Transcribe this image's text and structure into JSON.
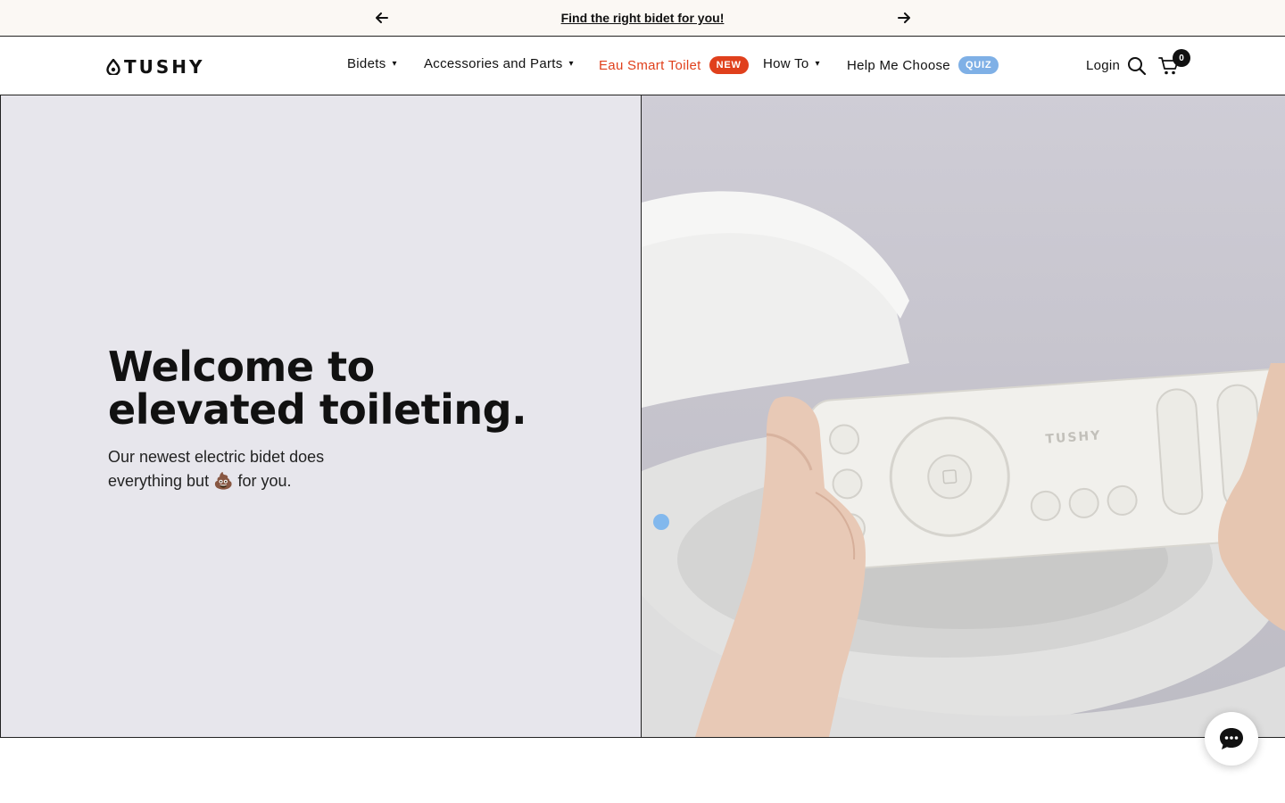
{
  "announcement": {
    "prev_icon": "arrow-left-icon",
    "text": "Find the right bidet for you!",
    "next_icon": "arrow-right-icon"
  },
  "header": {
    "logo_text": "TUSHY",
    "nav": [
      {
        "label": "Bidets",
        "has_dropdown": true
      },
      {
        "label": "Accessories and Parts",
        "has_dropdown": true
      },
      {
        "label": "Eau Smart Toilet",
        "badge": "NEW",
        "color": "#e0401c"
      },
      {
        "label": "How To",
        "has_dropdown": true
      },
      {
        "label": "Help Me Choose",
        "badge": "QUIZ"
      }
    ],
    "caret": "▾",
    "login_label": "Login",
    "cart_count": "0"
  },
  "hero": {
    "title": "Welcome to elevated toileting.",
    "subtitle": "Our newest electric bidet does everything but 💩 for you.",
    "left_bg": "#e7e6ec",
    "remote_brand": "TUSHY"
  },
  "colors": {
    "accent_red": "#e0401c",
    "quiz_blue": "#7fb0e6",
    "announce_bg": "#fbf8f4"
  },
  "chat": {
    "icon": "chat-bubble-icon"
  }
}
